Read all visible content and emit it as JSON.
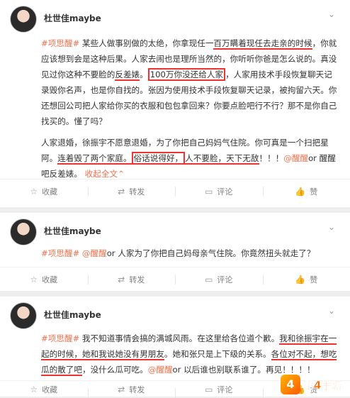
{
  "post1": {
    "user": "杜世佳maybe",
    "para1": {
      "tag": "#项思醒#",
      "t1": "某些人做事别做的太绝，你拿现任一",
      "u1": "百万瞒着现任去走亲的时候",
      "t2": "，你就应该想到会是这种后果。人家去闹也是理所当然的，你听听你爸是怎么说的。真没见过你这种不要脸的",
      "u2": "反差婊",
      "t3": "。",
      "box1": "100万你没还给人家",
      "t4": "，人家用技术手段恢复聊天记录毁你名声，也是你自找的。张因为使用技术手段恢复聊天记录，被拘留六天。你还想回公司把人家给你买的衣服和包包拿回来？你要点脸吧行不行？那不是你自己找买的。懂了吗？"
    },
    "para2": {
      "t1": "人家退婚，徐振宇不愿意退婚，为了你把自己妈妈气住院。你可真是一个扫把星阿。",
      "u1": "连着毁了两个家庭。",
      "u2": "俗话说得好，",
      "u3": "人不要脸，天下无敌",
      "t2": "！！！",
      "mention": "@醒醒",
      "t3": "or 醒醒吧反差婊。",
      "more": "收起全文",
      "caret": "⌃"
    },
    "actions": {
      "fav": "收藏",
      "repost": "转发",
      "comment": "评论",
      "like": "赞"
    }
  },
  "post2": {
    "user": "杜世佳maybe",
    "tag": "#项思醒#",
    "mention": "@醒醒",
    "text": "or 人家为了你把自己妈母亲气住院。你竟然扭头就走了？",
    "actions": {
      "fav": "收藏",
      "repost": "转发",
      "comment": "评论",
      "like": "赞"
    }
  },
  "post3": {
    "user": "杜世佳maybe",
    "tag": "#项思醒#",
    "t1": "我不知道事情会搞的满城风雨。在这里给各位道个歉。",
    "u1": "我和徐振宇在一起的时候，她和我说她没有男朋友",
    "t2": "。她和张只是上下级的关系。",
    "u2": "各位对不起，想吃瓜的散了吧",
    "t3": "，没什么瓜可吃。",
    "mention": "@醒醒",
    "t4": "or 以后谁也别联系谁了。再见！！！！",
    "actions": {
      "fav": "收藏",
      "repost": "转发",
      "comment": "评论",
      "like": "赞"
    }
  },
  "watermark": {
    "logo": "4",
    "text": "第4手游"
  }
}
